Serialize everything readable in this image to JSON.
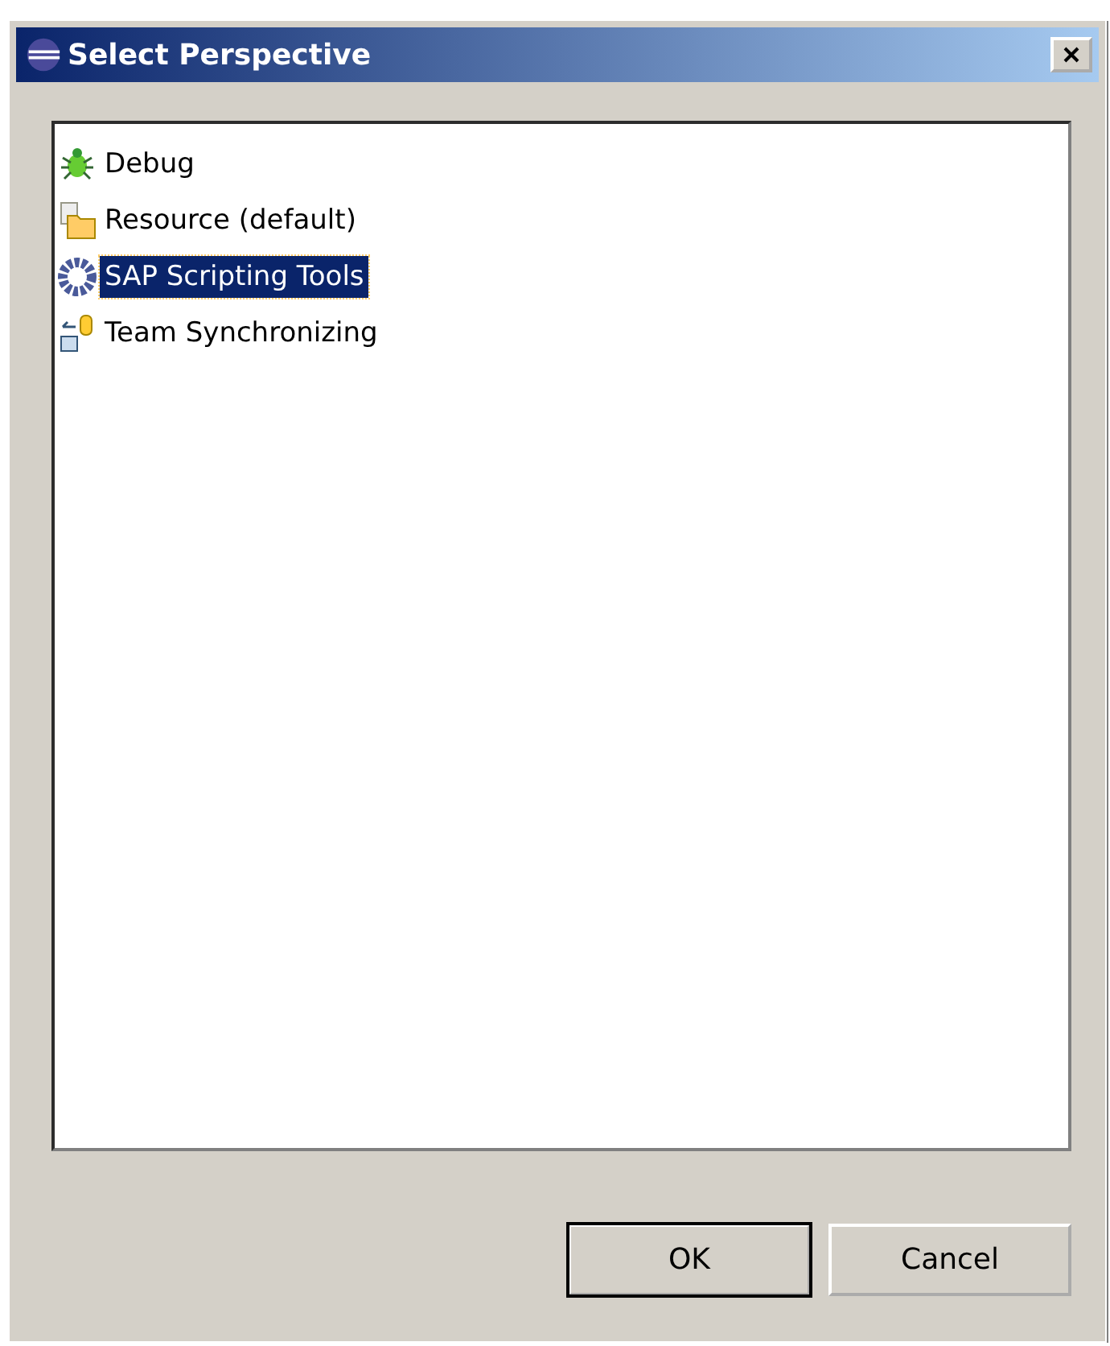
{
  "window": {
    "title": "Select Perspective"
  },
  "perspectives": [
    {
      "label": "Debug",
      "kind": "bug",
      "selected": false
    },
    {
      "label": "Resource (default)",
      "kind": "folder",
      "selected": false
    },
    {
      "label": "SAP Scripting Tools",
      "kind": "gear",
      "selected": true
    },
    {
      "label": "Team Synchronizing",
      "kind": "sync",
      "selected": false
    }
  ],
  "buttons": [
    {
      "label": "OK",
      "default": true
    },
    {
      "label": "Cancel",
      "default": false
    }
  ]
}
